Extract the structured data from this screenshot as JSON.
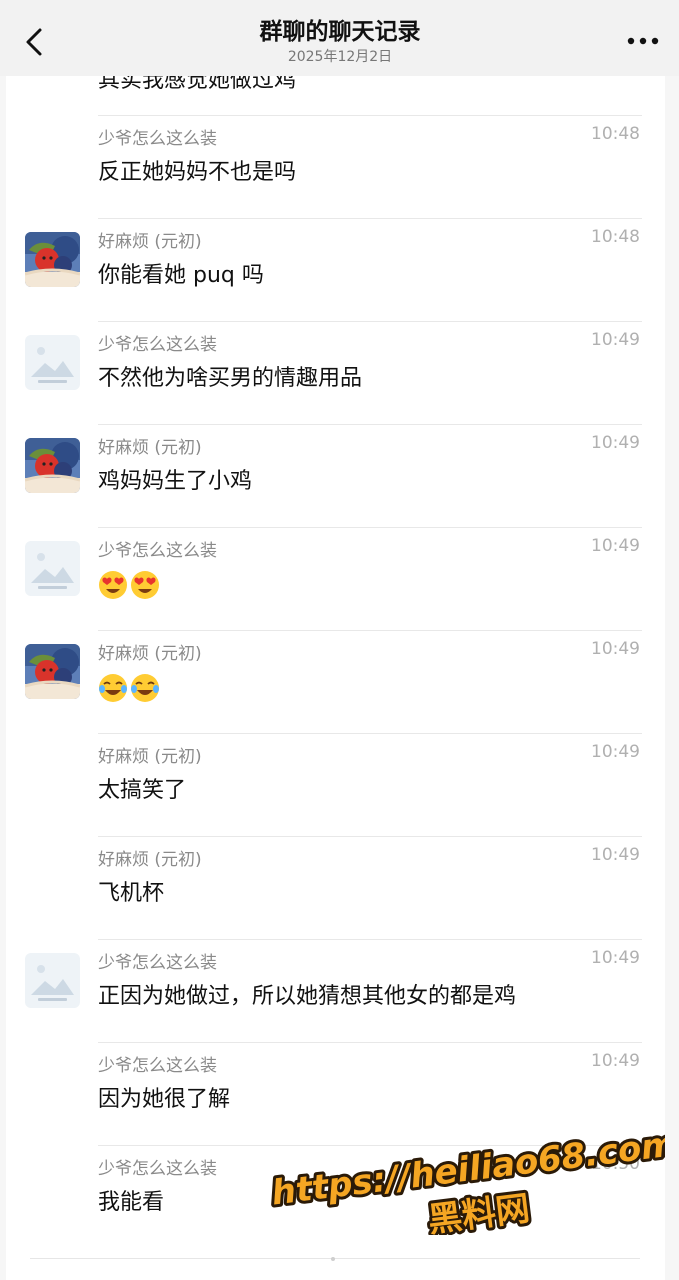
{
  "header": {
    "title": "群聊的聊天记录",
    "date": "2025年12月2日"
  },
  "partial_message": "其实我感觉她做过鸡",
  "messages": [
    {
      "sender": "少爷怎么这么装",
      "time": "10:48",
      "text": "反正她妈妈不也是吗",
      "avatar": "none"
    },
    {
      "sender": "好麻烦 (元初)",
      "time": "10:48",
      "text": "你能看她 puq 吗",
      "avatar": "fruit-avatar"
    },
    {
      "sender": "少爷怎么这么装",
      "time": "10:49",
      "text": "不然他为啥买男的情趣用品",
      "avatar": "placeholder-avatar"
    },
    {
      "sender": "好麻烦 (元初)",
      "time": "10:49",
      "text": "鸡妈妈生了小鸡",
      "avatar": "fruit-avatar"
    },
    {
      "sender": "少爷怎么这么装",
      "time": "10:49",
      "text": "",
      "emojis": [
        "heart-eyes-emoji",
        "heart-eyes-emoji"
      ],
      "avatar": "placeholder-avatar"
    },
    {
      "sender": "好麻烦 (元初)",
      "time": "10:49",
      "text": "",
      "emojis": [
        "tears-of-joy-emoji",
        "tears-of-joy-emoji"
      ],
      "avatar": "fruit-avatar"
    },
    {
      "sender": "好麻烦 (元初)",
      "time": "10:49",
      "text": "太搞笑了",
      "avatar": "none"
    },
    {
      "sender": "好麻烦 (元初)",
      "time": "10:49",
      "text": "飞机杯",
      "avatar": "none"
    },
    {
      "sender": "少爷怎么这么装",
      "time": "10:49",
      "text": "正因为她做过，所以她猜想其他女的都是鸡",
      "avatar": "placeholder-avatar"
    },
    {
      "sender": "少爷怎么这么装",
      "time": "10:49",
      "text": "因为她很了解",
      "avatar": "none"
    },
    {
      "sender": "少爷怎么这么装",
      "time": "10:50",
      "text": "我能看",
      "avatar": "none"
    }
  ],
  "watermark": {
    "url": "https://heiliao68.com",
    "label": "黑料网"
  },
  "colors": {
    "header_bg": "#f2f2f2",
    "sender": "#8a8a8a",
    "time": "#b0b0b0",
    "watermark_fill": "#f5a623",
    "watermark_stroke": "#2a1a08"
  }
}
